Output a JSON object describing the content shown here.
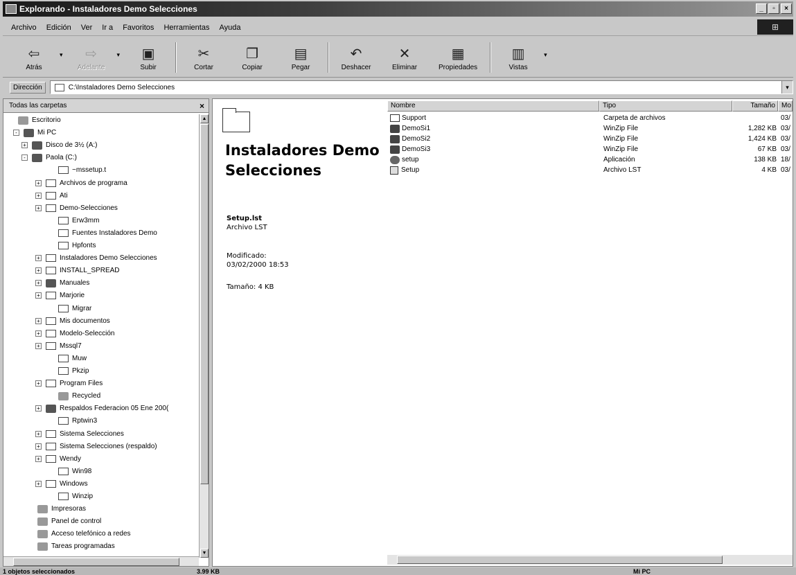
{
  "window": {
    "title": "Explorando - Instaladores Demo Selecciones",
    "controls": [
      "_",
      "▫",
      "×"
    ]
  },
  "menu": [
    "Archivo",
    "Edición",
    "Ver",
    "Ir a",
    "Favoritos",
    "Herramientas",
    "Ayuda"
  ],
  "toolbar": {
    "back": "Atrás",
    "forward": "Adelante",
    "up": "Subir",
    "cut": "Cortar",
    "copy": "Copiar",
    "paste": "Pegar",
    "undo": "Deshacer",
    "delete": "Eliminar",
    "properties": "Propiedades",
    "views": "Vistas"
  },
  "address": {
    "label": "Dirección",
    "value": "C:\\Instaladores Demo Selecciones"
  },
  "left_pane": {
    "header": "Todas las carpetas",
    "tree": [
      {
        "label": "Escritorio",
        "expander": ""
      },
      {
        "label": "Mi PC",
        "expander": "-"
      },
      {
        "label": "Disco de 3½ (A:)",
        "expander": "+"
      },
      {
        "label": "Paola (C:)",
        "expander": "-"
      },
      {
        "label": "~mssetup.t",
        "expander": ""
      },
      {
        "label": "Archivos de programa",
        "expander": "+"
      },
      {
        "label": "Ati",
        "expander": "+"
      },
      {
        "label": "Demo-Selecciones",
        "expander": "+"
      },
      {
        "label": "Erw3mm",
        "expander": ""
      },
      {
        "label": "Fuentes Instaladores Demo",
        "expander": ""
      },
      {
        "label": "Hpfonts",
        "expander": ""
      },
      {
        "label": "Instaladores Demo Selecciones",
        "expander": "+"
      },
      {
        "label": "INSTALL_SPREAD",
        "expander": "+"
      },
      {
        "label": "Manuales",
        "expander": "+"
      },
      {
        "label": "Marjorie",
        "expander": "+"
      },
      {
        "label": "Migrar",
        "expander": ""
      },
      {
        "label": "Mis documentos",
        "expander": "+"
      },
      {
        "label": "Modelo-Selección",
        "expander": "+"
      },
      {
        "label": "Mssql7",
        "expander": "+"
      },
      {
        "label": "Muw",
        "expander": ""
      },
      {
        "label": "Pkzip",
        "expander": ""
      },
      {
        "label": "Program Files",
        "expander": "+"
      },
      {
        "label": "Recycled",
        "expander": ""
      },
      {
        "label": "Respaldos Federacion 05 Ene 200(",
        "expander": "+"
      },
      {
        "label": "Rptwin3",
        "expander": ""
      },
      {
        "label": "Sistema Selecciones",
        "expander": "+"
      },
      {
        "label": "Sistema Selecciones (respaldo)",
        "expander": "+"
      },
      {
        "label": "Wendy",
        "expander": "+"
      },
      {
        "label": "Win98",
        "expander": ""
      },
      {
        "label": "Windows",
        "expander": "+"
      },
      {
        "label": "Winzip",
        "expander": ""
      },
      {
        "label": "Impresoras",
        "expander": ""
      },
      {
        "label": "Panel de control",
        "expander": ""
      },
      {
        "label": "Acceso telefónico a redes",
        "expander": ""
      },
      {
        "label": "Tareas programadas",
        "expander": ""
      }
    ]
  },
  "info_panel": {
    "title": "Instaladores Demo Selecciones",
    "selected_name": "Setup.lst",
    "selected_type": "Archivo LST",
    "modified_label": "Modificado:",
    "modified_value": "03/02/2000 18:53",
    "size": "Tamaño: 4 KB"
  },
  "file_list": {
    "columns": [
      "Nombre",
      "Tipo",
      "Tamaño",
      "Mo"
    ],
    "rows": [
      {
        "name": "Support",
        "type": "Carpeta de archivos",
        "size": "",
        "mod": "03/"
      },
      {
        "name": "DemoSi1",
        "type": "WinZip File",
        "size": "1,282 KB",
        "mod": "03/"
      },
      {
        "name": "DemoSi2",
        "type": "WinZip File",
        "size": "1,424 KB",
        "mod": "03/"
      },
      {
        "name": "DemoSi3",
        "type": "WinZip File",
        "size": "67 KB",
        "mod": "03/"
      },
      {
        "name": "setup",
        "type": "Aplicación",
        "size": "138 KB",
        "mod": "18/"
      },
      {
        "name": "Setup",
        "type": "Archivo LST",
        "size": "4 KB",
        "mod": "03/"
      }
    ]
  },
  "statusbar": {
    "selection": "1 objetos seleccionados",
    "size": "3.99 KB",
    "location": "Mi PC"
  }
}
